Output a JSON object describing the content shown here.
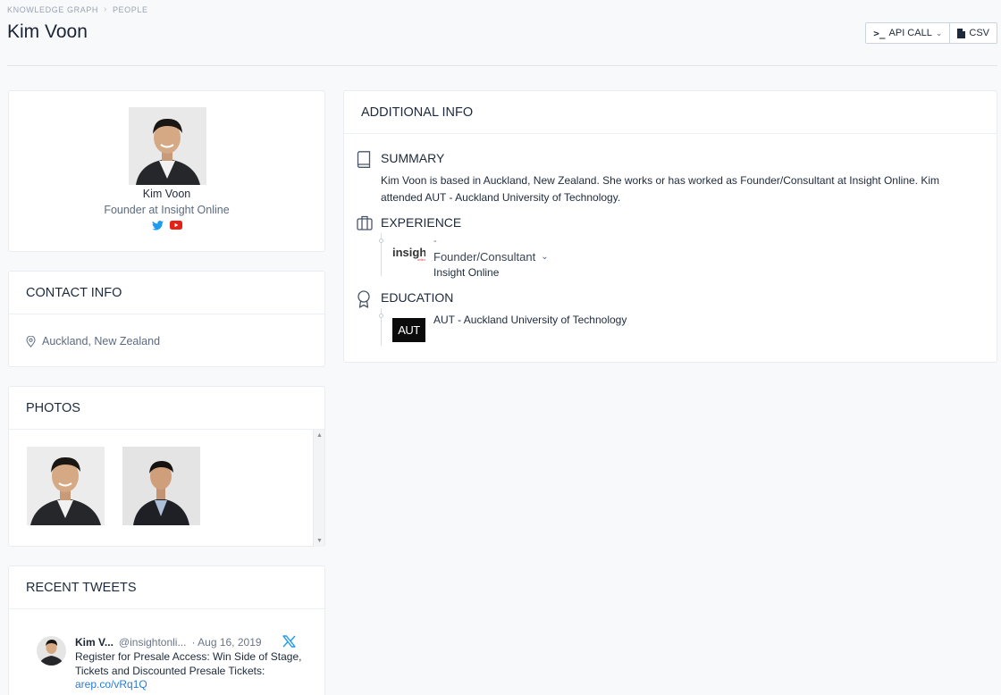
{
  "breadcrumb": {
    "items": [
      "KNOWLEDGE GRAPH",
      "PEOPLE"
    ]
  },
  "page_title": "Kim Voon",
  "toolbar": {
    "api_label": "API CALL",
    "csv_label": "CSV"
  },
  "profile": {
    "name": "Kim Voon",
    "title": "Founder at Insight Online",
    "socials": [
      "twitter-icon",
      "youtube-icon"
    ]
  },
  "contact": {
    "header": "CONTACT INFO",
    "location": "Auckland, New Zealand"
  },
  "photos": {
    "header": "PHOTOS"
  },
  "tweets": {
    "header": "RECENT TWEETS",
    "items": [
      {
        "name": "Kim V...",
        "handle": "@insightonli...",
        "date": "· Aug 16, 2019",
        "text": "Register for Presale Access: Win Side of Stage, Tickets and Discounted Presale Tickets:",
        "link": "arep.co/vRq1Q"
      }
    ]
  },
  "additional_info": {
    "header": "ADDITIONAL INFO",
    "summary": {
      "title": "SUMMARY",
      "text": "Kim Voon is based in Auckland, New Zealand. She works or has worked as Founder/Consultant at Insight Online. Kim attended AUT - Auckland University of Technology."
    },
    "experience": {
      "title": "EXPERIENCE",
      "items": [
        {
          "dates": "-",
          "role": "Founder/Consultant",
          "org": "Insight Online",
          "logo_text": "insight"
        }
      ]
    },
    "education": {
      "title": "EDUCATION",
      "items": [
        {
          "school": "AUT - Auckland University of Technology",
          "logo_text": "AUT"
        }
      ]
    }
  },
  "colors": {
    "accent_link": "#2b7bd3",
    "twitter_blue": "#1d9bf0",
    "youtube_red": "#e62117"
  }
}
